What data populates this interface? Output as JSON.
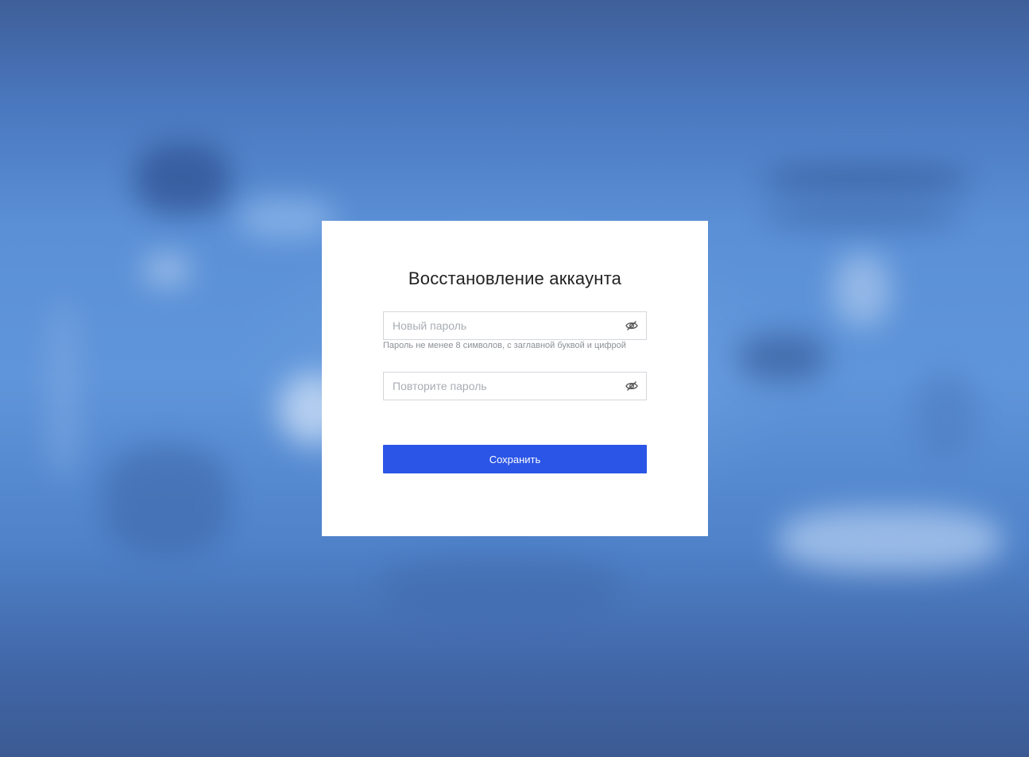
{
  "modal": {
    "title": "Восстановление аккаунта",
    "new_password": {
      "placeholder": "Новый пароль",
      "value": "",
      "icon": "eye-slash-icon"
    },
    "hint": "Пароль не менее 8 символов, с заглавной буквой и цифрой",
    "repeat_password": {
      "placeholder": "Повторите пароль",
      "value": "",
      "icon": "eye-slash-icon"
    },
    "save_label": "Сохранить"
  },
  "colors": {
    "accent": "#2b55e6",
    "background": "#5b90d6"
  }
}
